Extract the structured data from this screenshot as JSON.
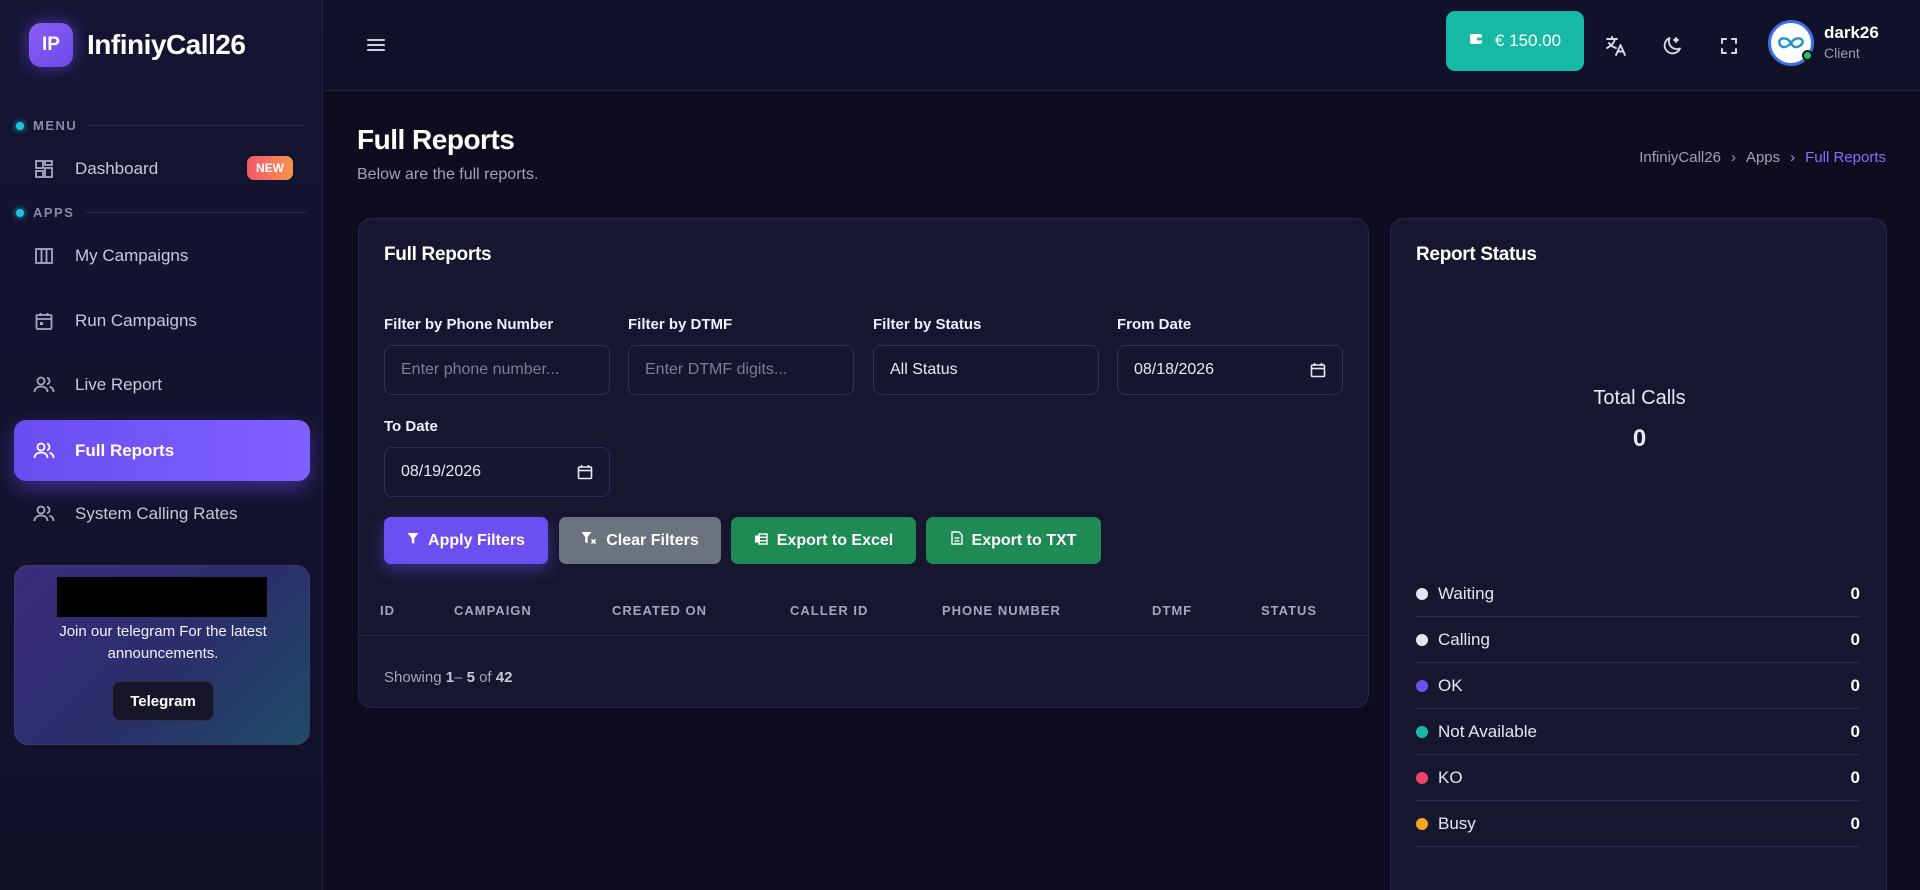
{
  "sidebar": {
    "logo": "IP",
    "brand": "InfiniyCall26",
    "menu_label": "MENU",
    "apps_label": "APPS",
    "items": [
      {
        "label": "Dashboard",
        "badge": "NEW"
      },
      {
        "label": "My Campaigns"
      },
      {
        "label": "Run Campaigns"
      },
      {
        "label": "Live Report"
      },
      {
        "label": "Full Reports"
      },
      {
        "label": "System Calling Rates"
      }
    ],
    "promo": {
      "text": "Join our telegram For the latest announcements.",
      "button": "Telegram"
    }
  },
  "topbar": {
    "balance": "€ 150.00",
    "user": {
      "name": "dark26",
      "role": "Client"
    },
    "icons": [
      "menu-icon",
      "wallet-icon",
      "translate-icon",
      "moon-icon",
      "fullscreen-icon"
    ]
  },
  "page": {
    "title": "Full Reports",
    "subtitle": "Below are the full reports.",
    "breadcrumb": [
      "InfiniyCall26",
      "Apps",
      "Full Reports"
    ]
  },
  "reports": {
    "title": "Full Reports",
    "filters": {
      "phone": {
        "label": "Filter by Phone Number",
        "placeholder": "Enter phone number..."
      },
      "dtmf": {
        "label": "Filter by DTMF",
        "placeholder": "Enter DTMF digits..."
      },
      "status": {
        "label": "Filter by Status",
        "value": "All Status"
      },
      "from": {
        "label": "From Date",
        "value": "08/18/2026"
      },
      "to": {
        "label": "To Date",
        "value": "08/19/2026"
      }
    },
    "buttons": {
      "apply": "Apply Filters",
      "clear": "Clear Filters",
      "excel": "Export to Excel",
      "txt": "Export to TXT"
    },
    "columns": [
      "ID",
      "CAMPAIGN",
      "CREATED ON",
      "CALLER ID",
      "PHONE NUMBER",
      "DTMF",
      "STATUS"
    ],
    "showing": {
      "prefix": "Showing ",
      "start": "1",
      "dash": "– ",
      "end": "5",
      "of": " of ",
      "total": "42"
    }
  },
  "status_card": {
    "title": "Report Status",
    "total_label": "Total Calls",
    "total_value": "0",
    "items": [
      {
        "label": "Waiting",
        "count": "0",
        "color": "#e6e6f0"
      },
      {
        "label": "Calling",
        "count": "0",
        "color": "#e6e6f0"
      },
      {
        "label": "OK",
        "count": "0",
        "color": "#6b4ff0"
      },
      {
        "label": "Not Available",
        "count": "0",
        "color": "#17b8a6"
      },
      {
        "label": "KO",
        "count": "0",
        "color": "#f0436b"
      },
      {
        "label": "Busy",
        "count": "0",
        "color": "#f5a524"
      }
    ]
  },
  "colors": {
    "accent": "#6b4ff0",
    "teal": "#17b8a6",
    "success": "#1e8a54",
    "secondary": "#6c727e"
  }
}
